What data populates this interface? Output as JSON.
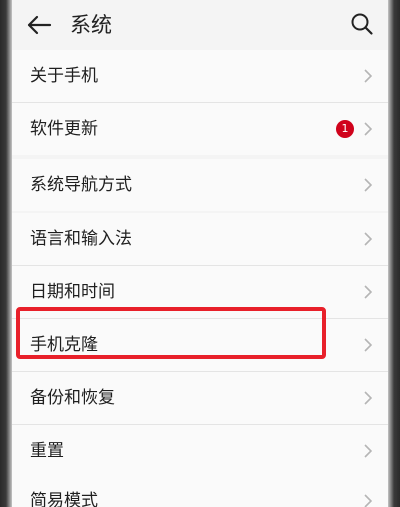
{
  "header": {
    "title": "系统"
  },
  "groups": [
    {
      "items": [
        {
          "label": "关于手机"
        },
        {
          "label": "软件更新",
          "badge": "1"
        }
      ]
    },
    {
      "items": [
        {
          "label": "系统导航方式"
        }
      ]
    },
    {
      "items": [
        {
          "label": "语言和输入法"
        },
        {
          "label": "日期和时间"
        },
        {
          "label": "手机克隆"
        },
        {
          "label": "备份和恢复"
        },
        {
          "label": "重置"
        }
      ]
    },
    {
      "items": [
        {
          "label": "简易模式"
        }
      ]
    }
  ],
  "colors": {
    "badge": "#d0021b",
    "highlight": "#e8202a"
  }
}
